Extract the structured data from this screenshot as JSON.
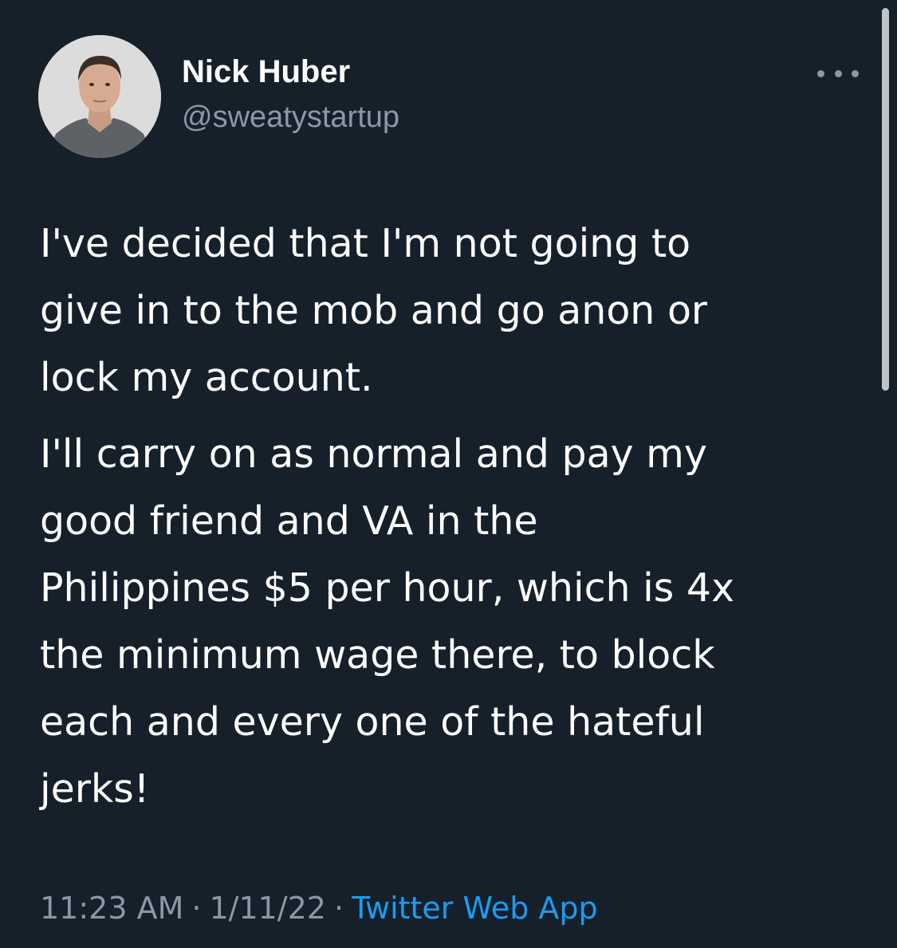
{
  "author": {
    "display_name": "Nick Huber",
    "handle": "@sweatystartup"
  },
  "tweet": {
    "paragraphs": [
      "I've decided that I'm not going to\ngive in to the mob and go anon or\nlock my account.",
      "I'll carry on as normal and pay my\ngood friend and VA in the\nPhilippines $5 per hour, which is 4x\nthe minimum wage there, to block\neach and every one of the hateful\njerks!"
    ]
  },
  "meta": {
    "time": "11:23 AM",
    "separator": "·",
    "date": "1/11/22",
    "source": "Twitter Web App"
  },
  "icons": {
    "more": "more-horizontal-icon"
  },
  "colors": {
    "background": "#15202b",
    "primary_text": "#ffffff",
    "secondary_text": "#8b98a5",
    "link": "#1d9bf0"
  }
}
